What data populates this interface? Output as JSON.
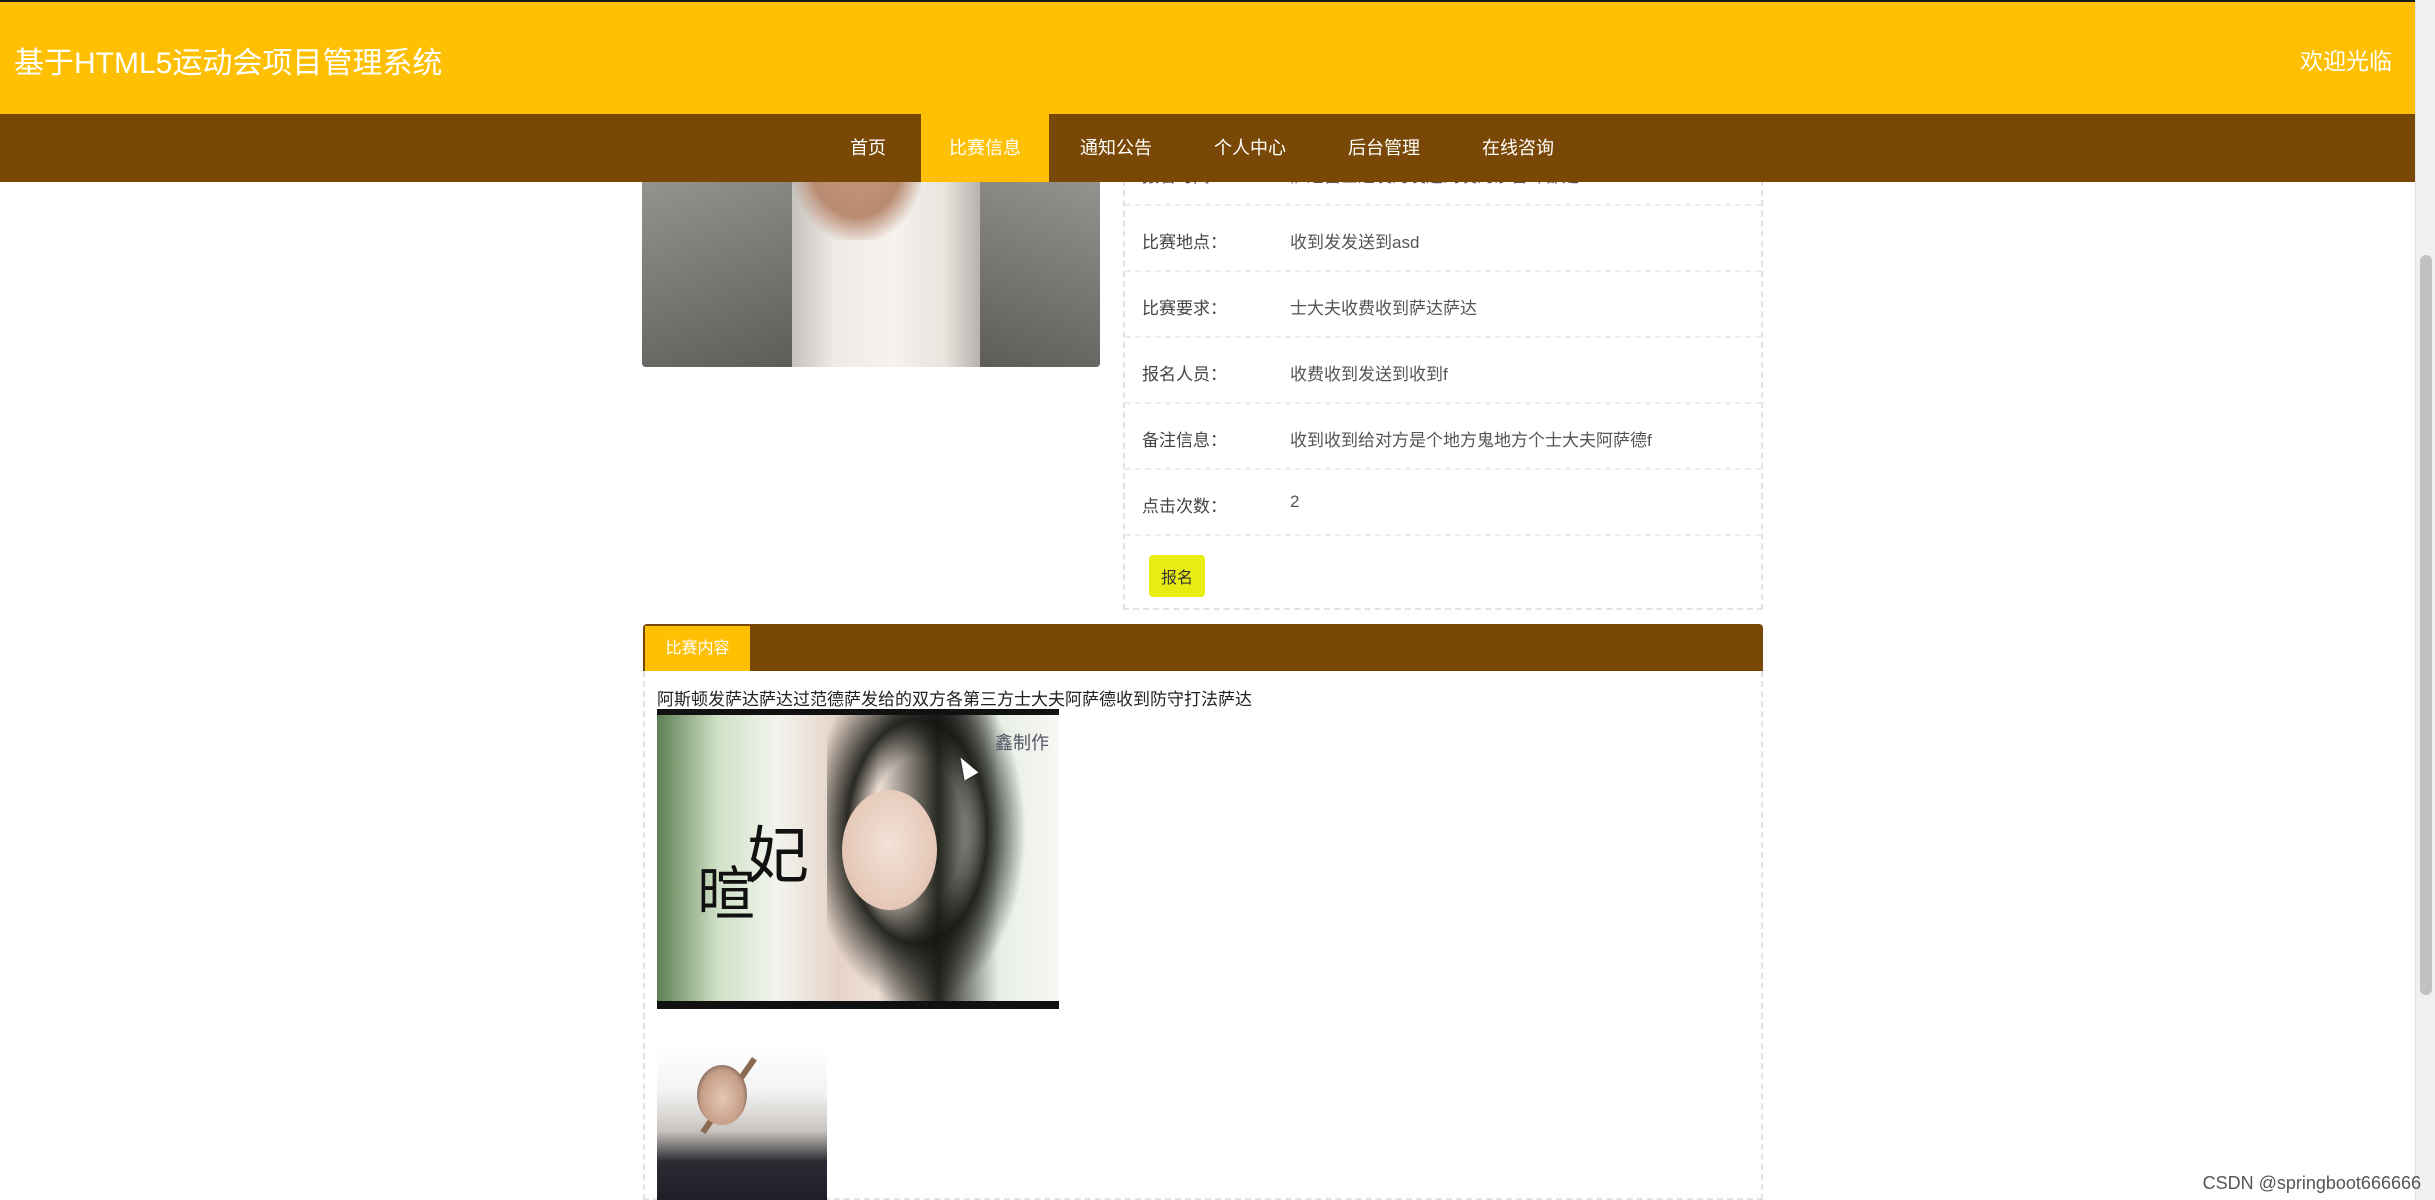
{
  "header": {
    "title": "基于HTML5运动会项目管理系统",
    "welcome": "欢迎光临"
  },
  "nav": {
    "items": [
      {
        "label": "首页",
        "active": false
      },
      {
        "label": "比赛信息",
        "active": true
      },
      {
        "label": "通知公告",
        "active": false
      },
      {
        "label": "个人中心",
        "active": false
      },
      {
        "label": "后台管理",
        "active": false
      },
      {
        "label": "在线咨询",
        "active": false
      }
    ]
  },
  "details": {
    "rows": [
      {
        "label": "报名时间：",
        "value": "萨达富士达发的发送到发的沙番斗都是"
      },
      {
        "label": "比赛地点：",
        "value": "收到发发送到asd"
      },
      {
        "label": "比赛要求：",
        "value": "士大夫收费收到萨达萨达"
      },
      {
        "label": "报名人员：",
        "value": "收费收到发送到收到f"
      },
      {
        "label": "备注信息：",
        "value": "收到收到给对方是个地方鬼地方个士大夫阿萨德f"
      },
      {
        "label": "点击次数：",
        "value": "2"
      }
    ],
    "signup_label": "报名"
  },
  "content_tab": {
    "label": "比赛内容",
    "text": "阿斯顿发萨达萨达过范德萨发给的双方各第三方士大夫阿萨德收到防守打法萨达",
    "image_caption": {
      "calligraphy_1": "妃",
      "calligraphy_2": "暄",
      "stamp": "鑫制作"
    }
  },
  "watermark": "CSDN @springboot666666"
}
